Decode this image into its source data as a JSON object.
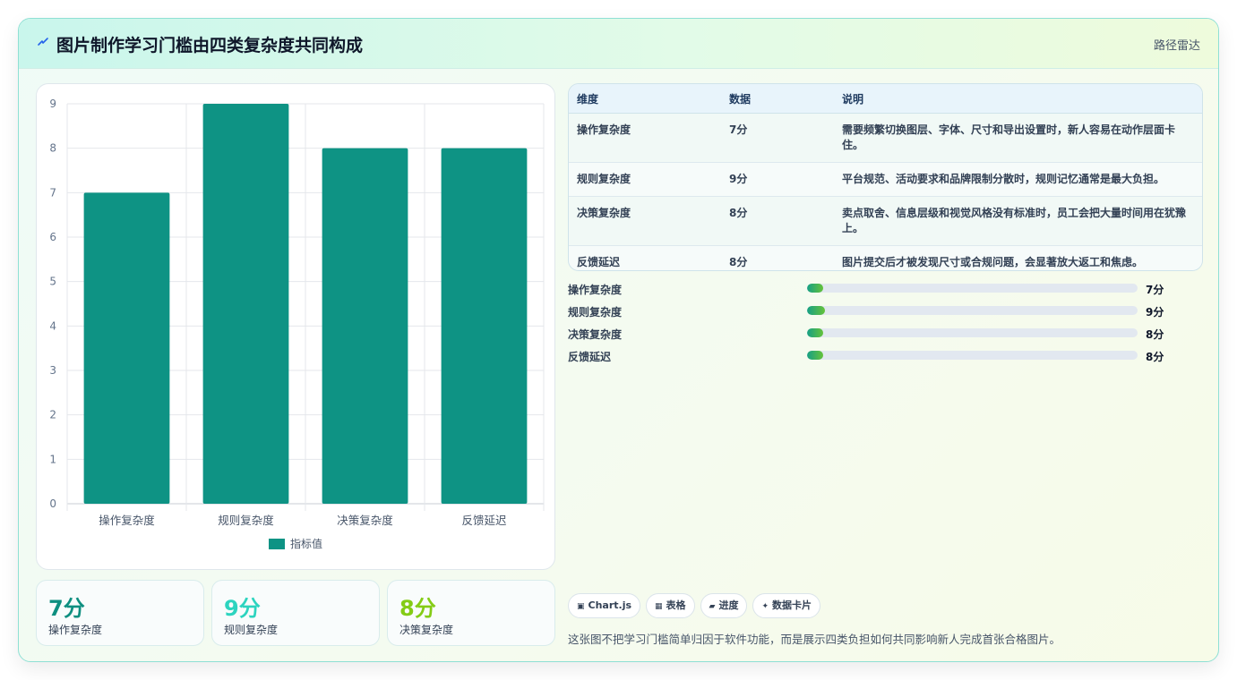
{
  "header": {
    "icon": "lightning-icon",
    "title": "图片制作学习门槛由四类复杂度共同构成",
    "right_label": "路径雷达"
  },
  "colors": {
    "bar": "#0e9384",
    "stat_values": [
      "#0e8f80",
      "#2dd4bf",
      "#84cc16"
    ]
  },
  "chart_data": {
    "type": "bar",
    "categories": [
      "操作复杂度",
      "规则复杂度",
      "决策复杂度",
      "反馈延迟"
    ],
    "series": [
      {
        "name": "指标值",
        "values": [
          7,
          9,
          8,
          8
        ]
      }
    ],
    "yticks": [
      "0",
      "1",
      "2",
      "3",
      "4",
      "5",
      "6",
      "7",
      "8",
      "9"
    ],
    "ylim": [
      0,
      9
    ],
    "grid": true,
    "legend": "bottom"
  },
  "stats": [
    {
      "value": "7分",
      "label": "操作复杂度"
    },
    {
      "value": "9分",
      "label": "规则复杂度"
    },
    {
      "value": "8分",
      "label": "决策复杂度"
    }
  ],
  "table": {
    "headers": [
      "维度",
      "数据",
      "说明"
    ],
    "rows": [
      {
        "dim": "操作复杂度",
        "data": "7分",
        "note": "需要频繁切换图层、字体、尺寸和导出设置时，新人容易在动作层面卡住。"
      },
      {
        "dim": "规则复杂度",
        "data": "9分",
        "note": "平台规范、活动要求和品牌限制分散时，规则记忆通常是最大负担。"
      },
      {
        "dim": "决策复杂度",
        "data": "8分",
        "note": "卖点取舍、信息层级和视觉风格没有标准时，员工会把大量时间用在犹豫上。"
      },
      {
        "dim": "反馈延迟",
        "data": "8分",
        "note": "图片提交后才被发现尺寸或合规问题，会显著放大返工和焦虑。"
      }
    ]
  },
  "progress": [
    {
      "label": "操作复杂度",
      "value": "7分",
      "fraction": 0.05
    },
    {
      "label": "规则复杂度",
      "value": "9分",
      "fraction": 0.055
    },
    {
      "label": "决策复杂度",
      "value": "8分",
      "fraction": 0.05
    },
    {
      "label": "反馈延迟",
      "value": "8分",
      "fraction": 0.05
    }
  ],
  "chips": [
    {
      "icon": "image-icon",
      "glyph": "▣",
      "label": "Chart.js"
    },
    {
      "icon": "table-icon",
      "glyph": "▦",
      "label": "表格"
    },
    {
      "icon": "progress-icon",
      "glyph": "▰",
      "label": "进度"
    },
    {
      "icon": "sparkle-icon",
      "glyph": "✦",
      "label": "数据卡片"
    }
  ],
  "footnote": "这张图不把学习门槛简单归因于软件功能，而是展示四类负担如何共同影响新人完成首张合格图片。"
}
